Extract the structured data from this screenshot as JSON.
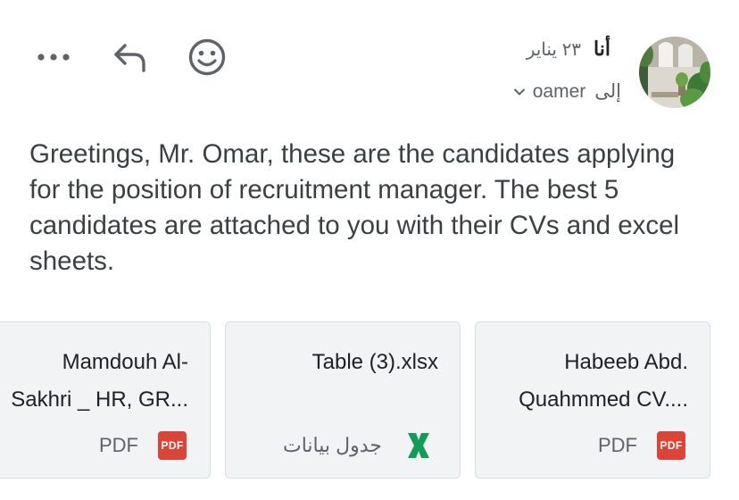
{
  "header": {
    "actions": [
      {
        "name": "more-options-button",
        "icon": "more-horizontal-icon"
      },
      {
        "name": "reply-button",
        "icon": "reply-arrow-icon"
      },
      {
        "name": "emoji-reaction-button",
        "icon": "smiley-face-icon"
      }
    ],
    "sender_name": "أنا",
    "date": "٢٣ يناير",
    "to_label": "إلى",
    "to_name": "oamer",
    "avatar_icon": "profile-photo-plants"
  },
  "message": {
    "body": "Greetings, Mr. Omar, these are the candidates applying for the position of recruitment manager. The best 5 candidates are attached to you with their CVs and excel sheets."
  },
  "attachments": [
    {
      "name_line1": "Mamdouh Al-",
      "name_line2": "Sakhri _ HR, GR...",
      "type_label": "PDF",
      "icon": "pdf-icon",
      "badge_text": "PDF",
      "badge_color": "#db4437"
    },
    {
      "name_line1": "Table (3).xlsx",
      "name_line2": "",
      "type_label": "جدول بيانات",
      "icon": "excel-icon",
      "icon_color": "#0f9d58"
    },
    {
      "name_line1": "Habeeb Abd.",
      "name_line2": "Quahmmed CV....",
      "type_label": "PDF",
      "icon": "pdf-icon",
      "badge_text": "PDF",
      "badge_color": "#db4437"
    }
  ]
}
